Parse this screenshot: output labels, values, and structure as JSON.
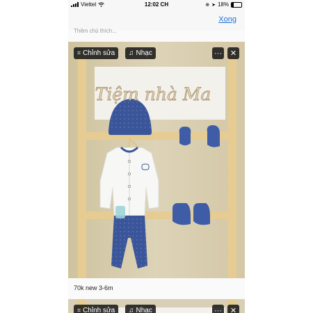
{
  "status_bar": {
    "carrier": "Viettel",
    "time": "12:02 CH",
    "battery_percent": "18%",
    "battery_level": 0.18
  },
  "nav": {
    "done_label": "Xong"
  },
  "caption_placeholder": "Thêm chú thích...",
  "photo_toolbar": {
    "edit_label": "Chỉnh sửa",
    "music_label": "Nhạc",
    "more_icon": "more-icon",
    "close_icon": "close-icon"
  },
  "photo": {
    "sign_text": "Tiệm nhà Ma",
    "caption": "70k new 3-6m"
  },
  "colors": {
    "accent": "#1a6ed8",
    "navy": "#3a5599",
    "wood": "#e6cc92",
    "overlay": "#141414"
  }
}
